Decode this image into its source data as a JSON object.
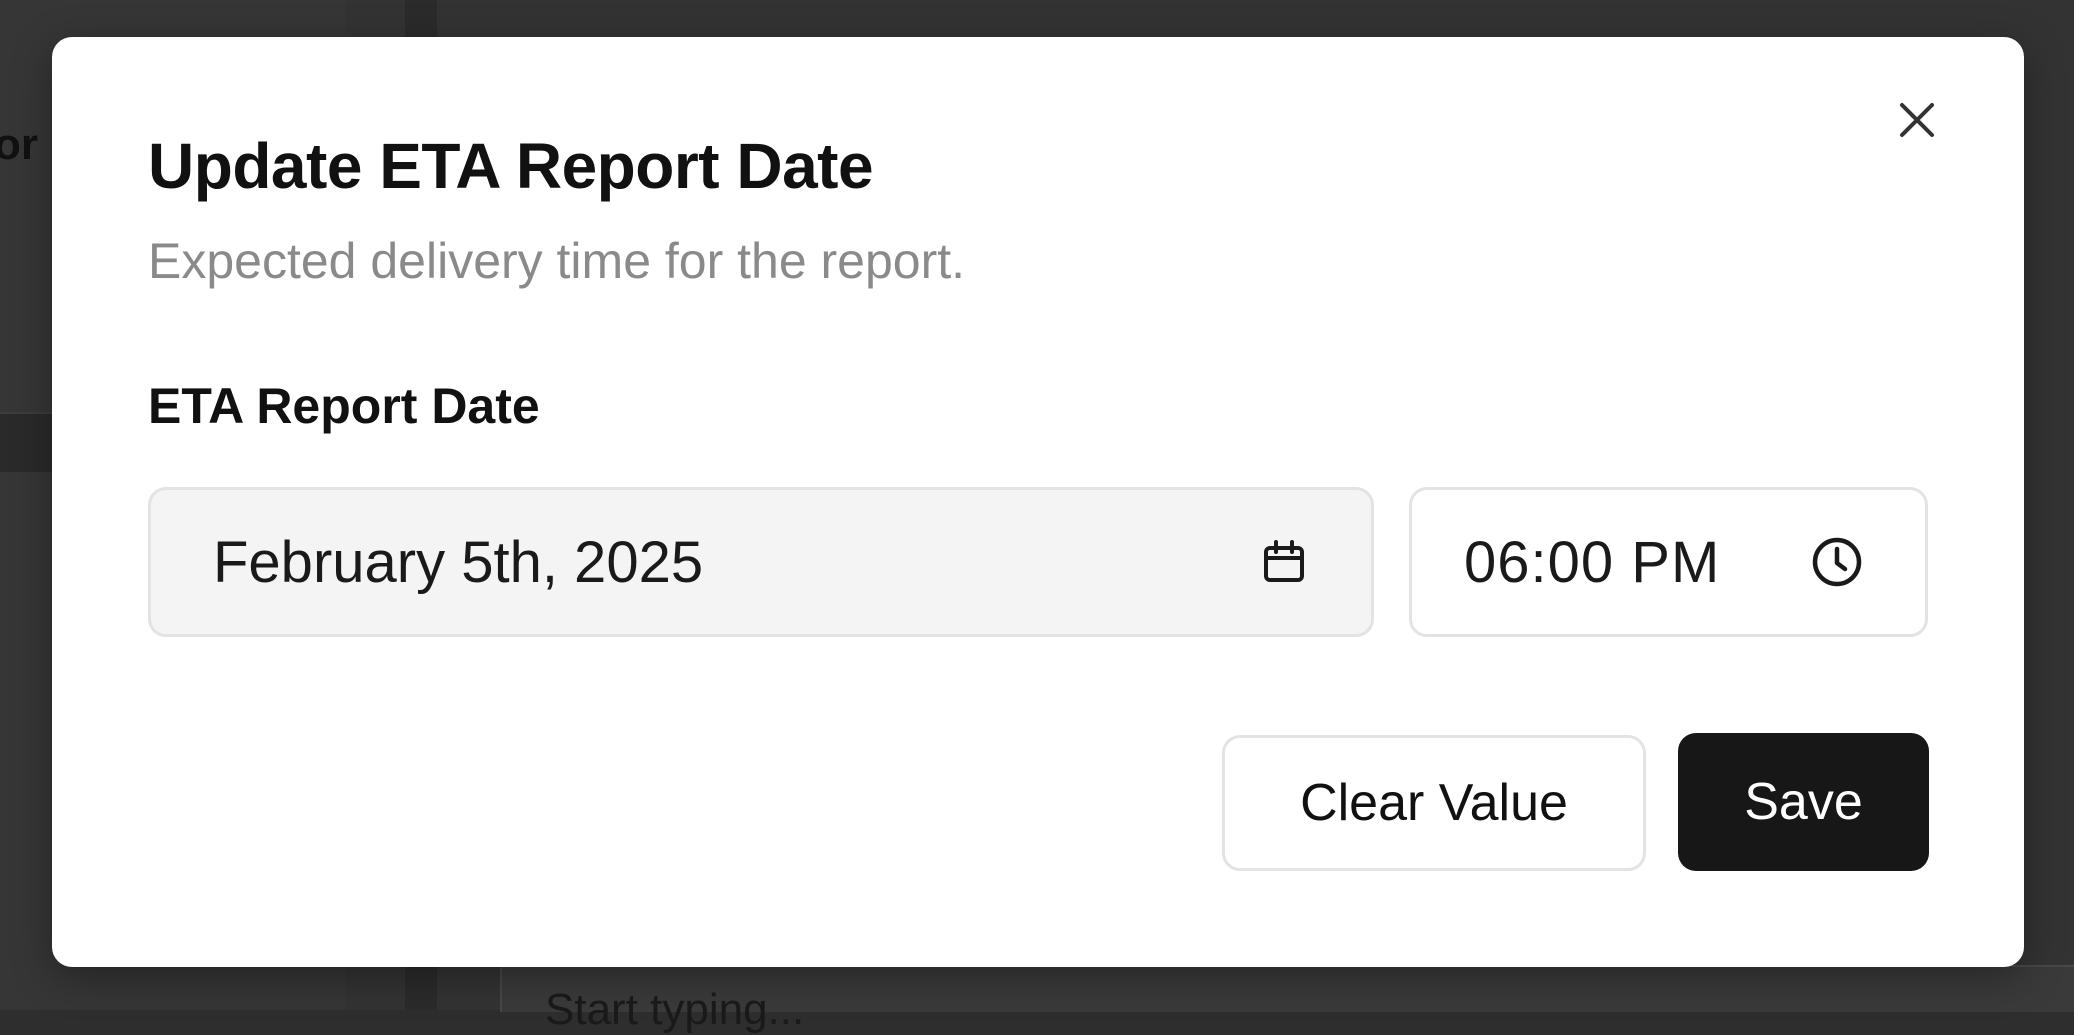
{
  "background": {
    "partial_text_left": "or",
    "partial_text_bottom": "Start typing..."
  },
  "modal": {
    "title": "Update ETA Report Date",
    "subtitle": "Expected delivery time for the report.",
    "close_icon": "close-icon",
    "field": {
      "label": "ETA Report Date",
      "date_value": "February 5th, 2025",
      "date_icon": "calendar-icon",
      "time_value": "06:00 PM",
      "time_icon": "clock-icon"
    },
    "actions": {
      "clear_label": "Clear Value",
      "save_label": "Save"
    }
  },
  "colors": {
    "overlay": "#333333",
    "primary_button": "#171717",
    "date_field_bg": "#f4f4f4",
    "subtitle": "#8a8a8a"
  }
}
